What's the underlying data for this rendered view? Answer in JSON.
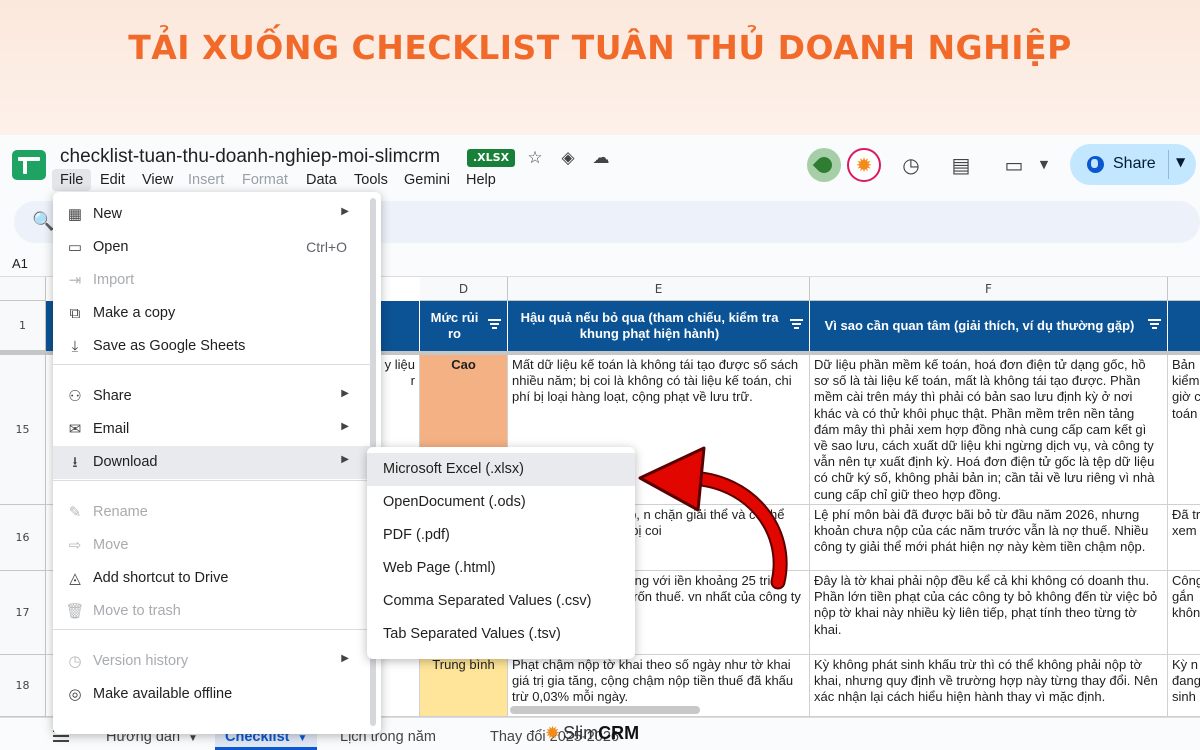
{
  "banner": {
    "title": "TẢI XUỐNG CHECKLIST TUÂN THỦ DOANH NGHIỆP"
  },
  "doc": {
    "title": "checklist-tuan-thu-doanh-nghiep-moi-slimcrm",
    "badge": ".XLSX"
  },
  "menubar": [
    {
      "label": "File",
      "disabled": false,
      "active": true
    },
    {
      "label": "Edit",
      "disabled": false
    },
    {
      "label": "View",
      "disabled": false
    },
    {
      "label": "Insert",
      "disabled": true
    },
    {
      "label": "Format",
      "disabled": true
    },
    {
      "label": "Data",
      "disabled": false
    },
    {
      "label": "Tools",
      "disabled": false
    },
    {
      "label": "Gemini",
      "disabled": false
    },
    {
      "label": "Help",
      "disabled": false
    }
  ],
  "share": {
    "label": "Share"
  },
  "namebox": "A1",
  "columns": {
    "D": "D",
    "E": "E",
    "F": "F"
  },
  "header_row": {
    "row_num": "1",
    "D": "Mức rủi ro",
    "E": "Hậu quả nếu bỏ qua (tham chiếu, kiểm tra khung phạt hiện hành)",
    "F": "Vì sao cần quan tâm (giải thích, ví dụ thường gặp)"
  },
  "rows": [
    {
      "num": "15",
      "left_partial": "y liệu\nr",
      "risk": "Cao",
      "E": "Mất dữ liệu kế toán là không tái tạo được số sách nhiều năm; bị coi là không có tài liệu kế toán, chi phí bị loại hàng loạt, cộng phạt về lưu trữ.",
      "F": "Dữ liệu phần mềm kế toán, hoá đơn điện tử dạng gốc, hồ sơ số là tài liệu kế toán, mất là không tái tạo được. Phần mềm cài trên máy thì phải có bản sao lưu định kỳ ở nơi khác và có thử khôi phục thật. Phần mềm trên nền tảng đám mây thì phải xem hợp đồng nhà cung cấp cam kết gì về sao lưu, cách xuất dữ liệu khi ngừng dịch vụ, và công ty vẫn nên tự xuất định kỳ. Hoá đơn điện tử gốc là tệp dữ liệu có chữ ký số, không phải bản in; cần tải về lưu riêng vì nhà cung cấp chỉ giữ theo hợp đồng.",
      "G": "Bản\nkiểm\ngiờ c\ntoán"
    },
    {
      "num": "16",
      "left_partial": "",
      "risk": "",
      "E": "n cộng tiền chậm nộp, n chặn giải thể và có thể uất cảnh khi công ty bị coi",
      "F": "Lệ phí môn bài đã được bãi bỏ từ đầu năm 2026, nhưng khoản chưa nộp của các năm trước vẫn là nợ thuế. Nhiều công ty giải thể mới phát hiện nợ này kèm tiền chậm nộp.",
      "G": "Đã tr\nxem l"
    },
    {
      "num": "17",
      "left_partial": "",
      "risk": "",
      "E": "hai theo số ngày, khung với iền khoảng 25 triệu mỗi tờ thể bị xem là trốn thuế. vn nhất của công ty bỏ",
      "F": "Đây là tờ khai phải nộp đều kể cả khi không có doanh thu. Phần lớn tiền phạt của các công ty bỏ không đến từ việc bỏ nộp tờ khai này nhiều kỳ liên tiếp, phạt tính theo từng tờ khai.",
      "G": "Công\ngắn\nkhôn"
    },
    {
      "num": "18",
      "left_partial": "",
      "risk": "Trung bình",
      "E": "Phạt chậm nộp tờ khai theo số ngày như tờ khai giá trị gia tăng, cộng chậm nộp tiền thuế đã khấu trừ 0,03% mỗi ngày.",
      "F": "Kỳ không phát sinh khấu trừ thì có thể không phải nộp tờ khai, nhưng quy định về trường hợp này từng thay đổi. Nên xác nhận lại cách hiểu hiện hành thay vì mặc định.",
      "G": "Kỳ n\nđang\nsinh"
    }
  ],
  "file_menu": {
    "items": [
      {
        "icon": "new-icon",
        "glyph": "▦",
        "label": "New",
        "submenu": true,
        "disabled": false
      },
      {
        "icon": "folder-icon",
        "glyph": "▭",
        "label": "Open",
        "shortcut": "Ctrl+O",
        "disabled": false
      },
      {
        "icon": "import-icon",
        "glyph": "⇥",
        "label": "Import",
        "disabled": true
      },
      {
        "icon": "copy-icon",
        "glyph": "⧉",
        "label": "Make a copy",
        "disabled": false
      },
      {
        "icon": "save-sheets-icon",
        "glyph": "⤓",
        "label": "Save as Google Sheets",
        "disabled": false
      },
      {
        "icon": "person-add-icon",
        "glyph": "⚇",
        "label": "Share",
        "submenu": true,
        "disabled": false
      },
      {
        "icon": "email-icon",
        "glyph": "✉",
        "label": "Email",
        "submenu": true,
        "disabled": false
      },
      {
        "icon": "download-icon",
        "glyph": "⭳",
        "label": "Download",
        "submenu": true,
        "disabled": false,
        "hovered": true
      },
      {
        "icon": "pencil-icon",
        "glyph": "✎",
        "label": "Rename",
        "disabled": true
      },
      {
        "icon": "move-icon",
        "glyph": "⇨",
        "label": "Move",
        "disabled": true
      },
      {
        "icon": "drive-shortcut-icon",
        "glyph": "◬",
        "label": "Add shortcut to Drive",
        "disabled": false
      },
      {
        "icon": "trash-icon",
        "glyph": "🗑",
        "label": "Move to trash",
        "disabled": true
      },
      {
        "icon": "history-icon",
        "glyph": "◷",
        "label": "Version history",
        "submenu": true,
        "disabled": true
      },
      {
        "icon": "offline-icon",
        "glyph": "◎",
        "label": "Make available offline",
        "disabled": false
      }
    ]
  },
  "download_menu": [
    {
      "label": "Microsoft Excel (.xlsx)",
      "hovered": true
    },
    {
      "label": "OpenDocument (.ods)"
    },
    {
      "label": "PDF (.pdf)"
    },
    {
      "label": "Web Page (.html)"
    },
    {
      "label": "Comma Separated Values (.csv)"
    },
    {
      "label": "Tab Separated Values (.tsv)"
    }
  ],
  "sheet_tabs": [
    {
      "label": "Hướng dẫn",
      "active": false
    },
    {
      "label": "Checklist",
      "active": true
    },
    {
      "label": "Lịch trong năm",
      "active": false
    },
    {
      "label": "Thay đổi 2025-2026",
      "active": false
    }
  ],
  "watermark": {
    "brand_a": "Slim",
    "brand_b": "CRM"
  },
  "colors": {
    "banner_title": "#f26a2a",
    "header_fill": "#0b5394",
    "risk_high": "#f4b183",
    "risk_medium": "#ffe599",
    "arrow": "#e10600"
  }
}
